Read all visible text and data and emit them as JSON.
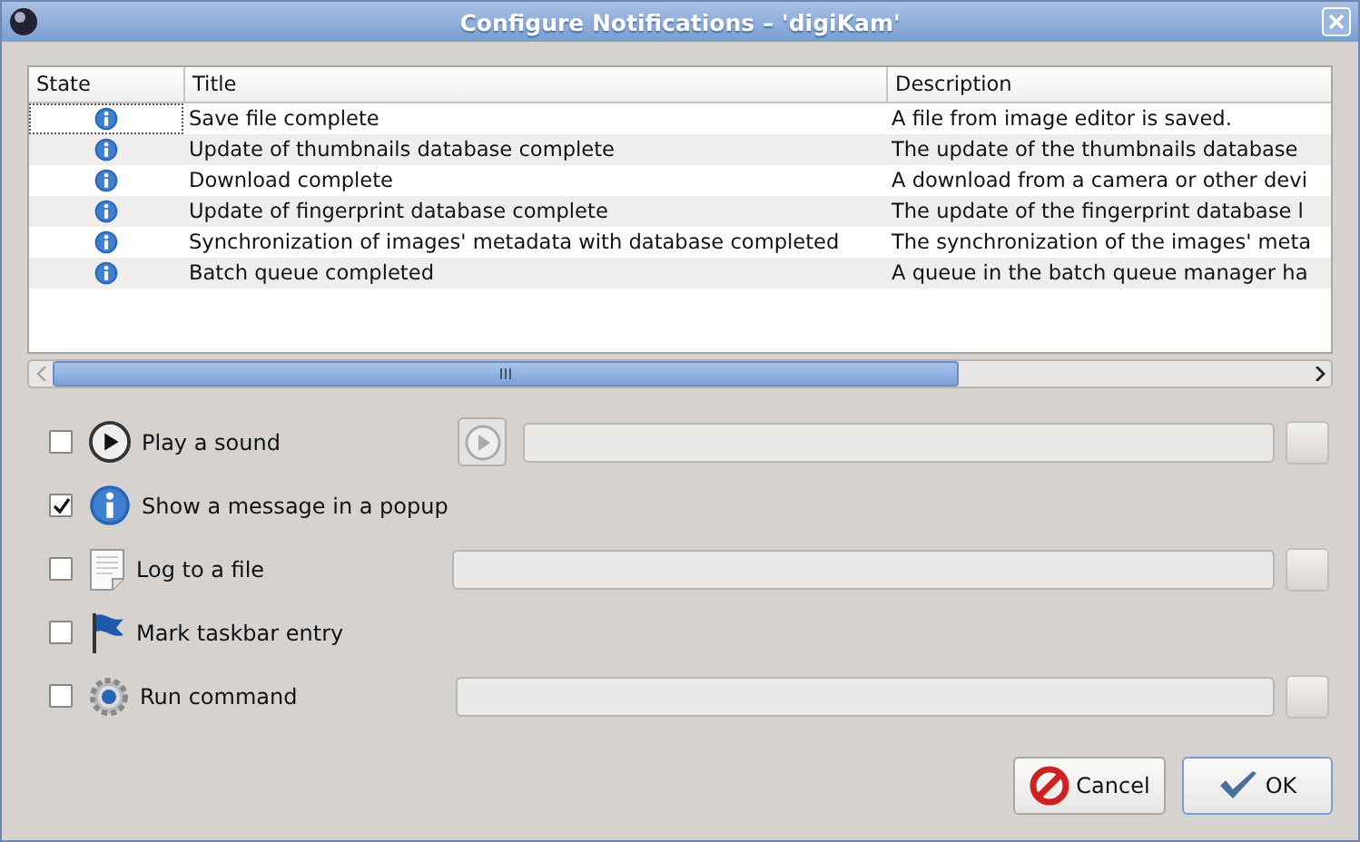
{
  "window": {
    "title": "Configure Notifications – 'digiKam'"
  },
  "table": {
    "columns": [
      "State",
      "Title",
      "Description"
    ],
    "rows": [
      {
        "title": "Save file complete",
        "description": "A file from image editor is saved.",
        "selected": false,
        "focused": true
      },
      {
        "title": "Update of thumbnails database complete",
        "description": "The update of the thumbnails database",
        "selected": false,
        "focused": false
      },
      {
        "title": "Download complete",
        "description": "A download from a camera or other devi",
        "selected": false,
        "focused": false
      },
      {
        "title": "Update of fingerprint database complete",
        "description": "The update of the fingerprint database l",
        "selected": false,
        "focused": false
      },
      {
        "title": "Synchronization of images' metadata with database completed",
        "description": "The synchronization of the images' meta",
        "selected": false,
        "focused": false
      },
      {
        "title": "Batch queue completed",
        "description": "A queue in the batch queue manager ha",
        "selected": false,
        "focused": false
      }
    ]
  },
  "actions": [
    {
      "kind": "sound",
      "label": "Play a sound",
      "checked": false
    },
    {
      "kind": "popup",
      "label": "Show a message in a popup",
      "checked": true
    },
    {
      "kind": "log",
      "label": "Log to a file",
      "checked": false
    },
    {
      "kind": "taskbar",
      "label": "Mark taskbar entry",
      "checked": false
    },
    {
      "kind": "command",
      "label": "Run command",
      "checked": false
    }
  ],
  "buttons": [
    {
      "kind": "cancel",
      "label": "Cancel",
      "default": false
    },
    {
      "kind": "ok",
      "label": "OK",
      "default": true
    }
  ]
}
